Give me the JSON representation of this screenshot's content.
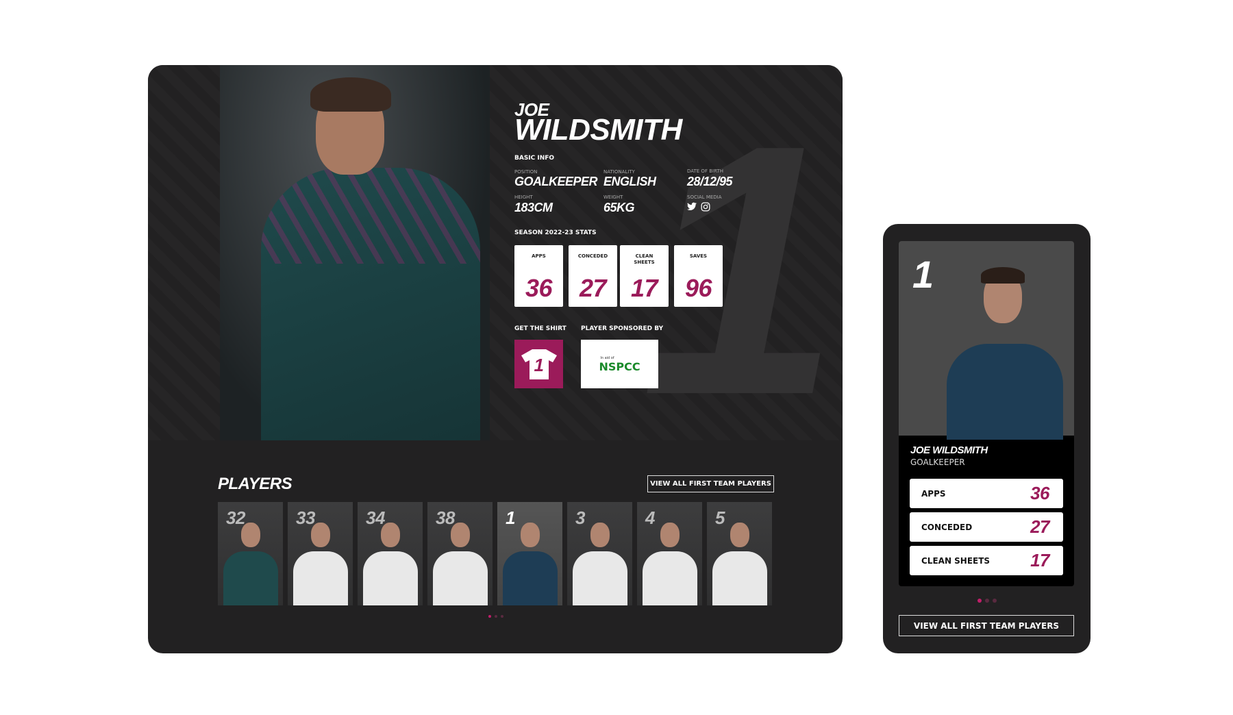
{
  "player": {
    "first_name": "JOE",
    "last_name": "WILDSMITH",
    "full_name": "JOE WILDSMITH",
    "number": "1",
    "basic_info_label": "BASIC INFO",
    "fields": {
      "position_label": "POSITION",
      "position": "GOALKEEPER",
      "nationality_label": "NATIONALITY",
      "nationality": "ENGLISH",
      "dob_label": "DATE OF BIRTH",
      "dob": "28/12/95",
      "height_label": "HEIGHT",
      "height": "183CM",
      "weight_label": "WEIGHT",
      "weight": "65KG",
      "social_label": "SOCIAL MEDIA"
    },
    "social_icons": [
      "twitter-icon",
      "instagram-icon"
    ]
  },
  "stats": {
    "title": "SEASON 2022-23 STATS",
    "items": [
      {
        "label": "APPS",
        "value": "36"
      },
      {
        "label": "CONCEDED",
        "value": "27"
      },
      {
        "label": "CLEAN SHEETS",
        "value": "17"
      },
      {
        "label": "SAVES",
        "value": "96"
      }
    ]
  },
  "shirt": {
    "label": "GET THE SHIRT",
    "number": "1"
  },
  "sponsor": {
    "label": "PLAYER SPONSORED BY",
    "small": "In aid of",
    "name": "NSPCC"
  },
  "players": {
    "title": "PLAYERS",
    "button": "VIEW ALL FIRST TEAM PLAYERS",
    "numbers": [
      "32",
      "33",
      "34",
      "38",
      "1",
      "3",
      "4",
      "5"
    ],
    "active_index": 4
  },
  "mobile": {
    "name": "JOE WILDSMITH",
    "position": "GOALKEEPER",
    "number": "1",
    "rows": [
      {
        "label": "APPS",
        "value": "36"
      },
      {
        "label": "CONCEDED",
        "value": "27"
      },
      {
        "label": "CLEAN SHEETS",
        "value": "17"
      }
    ],
    "button": "VIEW ALL FIRST TEAM PLAYERS"
  },
  "colors": {
    "accent": "#9b1b5a",
    "panel": "#222122",
    "sponsor_green": "#1a8a2a"
  }
}
